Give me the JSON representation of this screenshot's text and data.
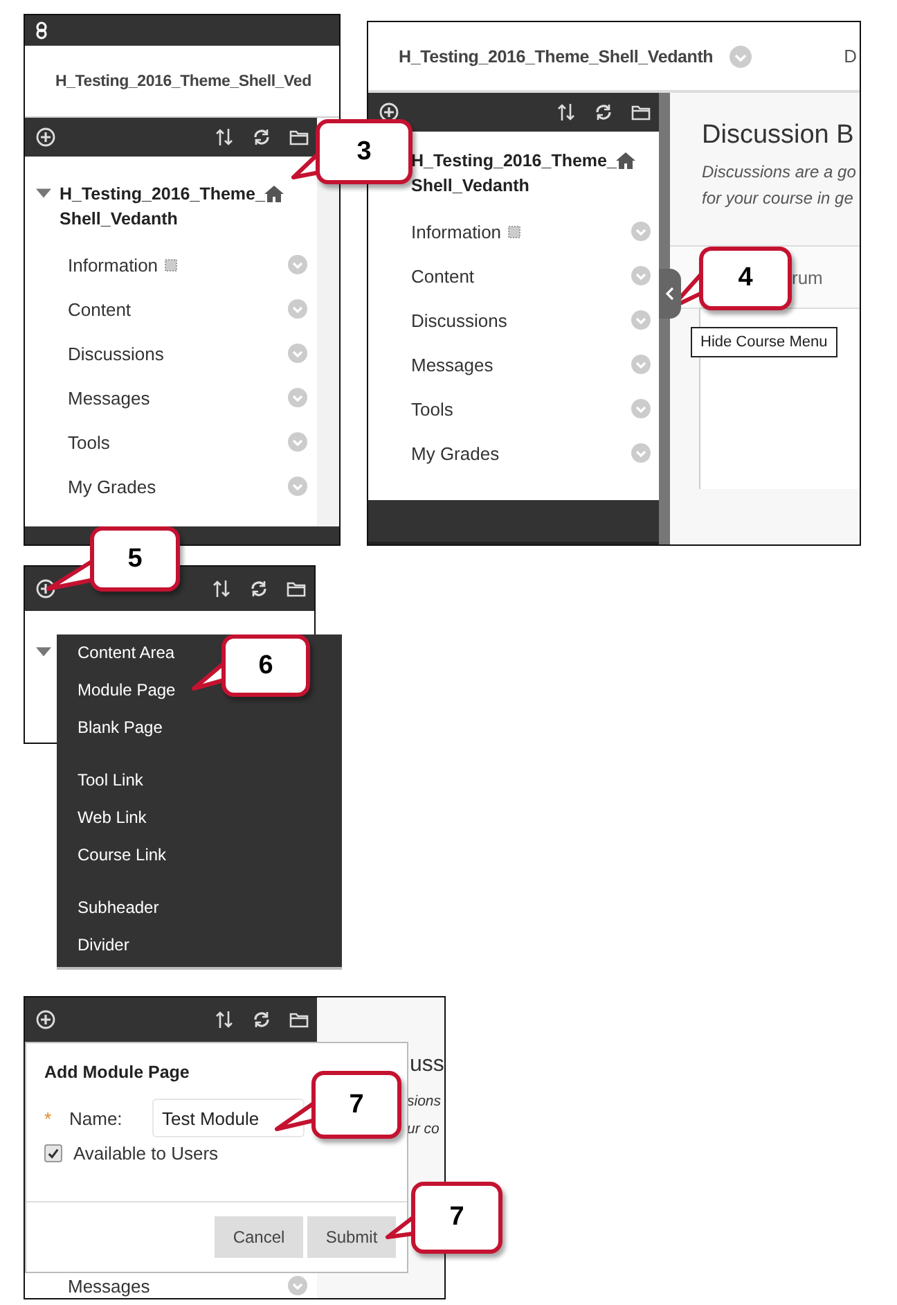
{
  "screen_1": {
    "course_title": "H_Testing_2016_Theme_Shell_Ved",
    "menu_title": "H_Testing_2016_Theme_Shell_Vedanth",
    "menu_items": [
      {
        "label": "Information",
        "hidden": true
      },
      {
        "label": "Content",
        "hidden": false
      },
      {
        "label": "Discussions",
        "hidden": false
      },
      {
        "label": "Messages",
        "hidden": false
      },
      {
        "label": "Tools",
        "hidden": false
      },
      {
        "label": "My Grades",
        "hidden": false
      }
    ]
  },
  "screen_2": {
    "course_title": "H_Testing_2016_Theme_Shell_Vedanth",
    "header_cut": "D",
    "menu_title": "H_Testing_2016_Theme_Shell_Vedanth",
    "menu_items": [
      {
        "label": "Information",
        "hidden": true
      },
      {
        "label": "Content",
        "hidden": false
      },
      {
        "label": "Discussions",
        "hidden": false
      },
      {
        "label": "Messages",
        "hidden": false
      },
      {
        "label": "Tools",
        "hidden": false
      },
      {
        "label": "My Grades",
        "hidden": false
      }
    ],
    "page_title": "Discussion B",
    "description_lines": [
      "Discussions are a go",
      "for your course in ge"
    ],
    "column_header": "rum",
    "tooltip": "Hide Course Menu"
  },
  "screen_3": {
    "add_menu_groups": [
      [
        "Content Area",
        "Module Page",
        "Blank Page"
      ],
      [
        "Tool Link",
        "Web Link",
        "Course Link"
      ],
      [
        "Subheader",
        "Divider"
      ]
    ]
  },
  "screen_4": {
    "background_texts": [
      "uss",
      "sions",
      "ur co"
    ],
    "menu_item": "Messages",
    "dialog": {
      "title": "Add Module Page",
      "required_mark": "*",
      "name_label": "Name:",
      "name_value": "Test Module",
      "available_label": "Available to Users",
      "available_checked": true,
      "buttons": [
        "Cancel",
        "Submit"
      ]
    }
  },
  "callouts": [
    {
      "label": "3"
    },
    {
      "label": "4"
    },
    {
      "label": "5"
    },
    {
      "label": "6"
    },
    {
      "label": "7"
    },
    {
      "label": "7"
    }
  ]
}
